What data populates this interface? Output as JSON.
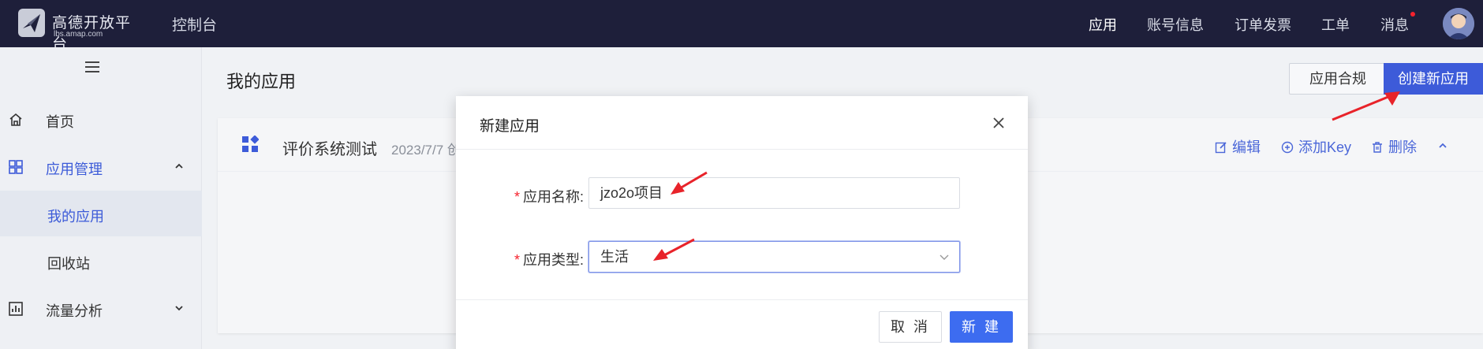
{
  "topbar": {
    "logo_cn": "高德开放平台",
    "logo_en": "lbs.amap.com",
    "console": "控制台",
    "nav": [
      "应用",
      "账号信息",
      "订单发票",
      "工单",
      "消息"
    ]
  },
  "sidebar": {
    "items": [
      {
        "label": "首页",
        "icon": "home-icon"
      },
      {
        "label": "应用管理",
        "icon": "grid-icon"
      },
      {
        "label": "我的应用"
      },
      {
        "label": "回收站"
      },
      {
        "label": "流量分析",
        "icon": "chart-icon"
      }
    ]
  },
  "main": {
    "title": "我的应用",
    "compliance_button": "应用合规",
    "create_button": "创建新应用",
    "card": {
      "app_name": "评价系统测试",
      "date": "2023/7/7 创",
      "edit": "编辑",
      "add_key": "添加Key",
      "delete": "删除"
    }
  },
  "dialog": {
    "title": "新建应用",
    "name_label": "应用名称:",
    "name_value": "jzo2o项目",
    "type_label": "应用类型:",
    "type_value": "生活",
    "cancel": "取 消",
    "create": "新 建"
  },
  "colors": {
    "topbar_bg": "#1e1f3a",
    "primary": "#3d5bd9",
    "required": "#f5222d",
    "annotation_arrow": "#e8232a"
  }
}
